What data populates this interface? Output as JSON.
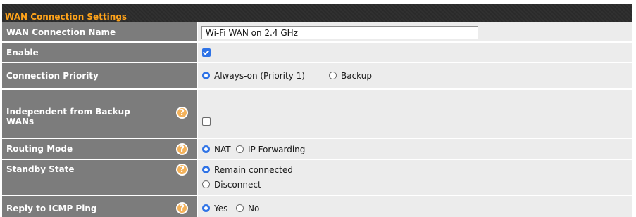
{
  "section_title": "WAN Connection Settings",
  "rows": {
    "connection_name": {
      "label": "WAN Connection Name",
      "value": "Wi-Fi WAN on 2.4 GHz"
    },
    "enable": {
      "label": "Enable",
      "checked": true
    },
    "connection_priority": {
      "label": "Connection Priority",
      "options": [
        "Always-on (Priority 1)",
        "Backup"
      ],
      "selected": "Always-on (Priority 1)"
    },
    "independent_from_backup": {
      "label_line1": "Independent from Backup",
      "label_line2": "WANs",
      "checked": false,
      "help_icon": "question-circle-icon"
    },
    "routing_mode": {
      "label": "Routing Mode",
      "options": [
        "NAT",
        "IP Forwarding"
      ],
      "selected": "NAT",
      "help_icon": "question-circle-icon"
    },
    "standby_state": {
      "label": "Standby State",
      "options": [
        "Remain connected",
        "Disconnect"
      ],
      "selected": "Remain connected",
      "help_icon": "question-circle-icon"
    },
    "reply_icmp": {
      "label": "Reply to ICMP Ping",
      "options": [
        "Yes",
        "No"
      ],
      "selected": "Yes",
      "help_icon": "question-circle-icon"
    }
  },
  "help_glyph": "?",
  "colors": {
    "header_bg": "#2a2a2a",
    "header_text": "#ffa31a",
    "label_bg": "#7c7c7c",
    "value_bg": "#ececec",
    "accent": "#2f73e6",
    "help_icon": "#f3b25b"
  }
}
